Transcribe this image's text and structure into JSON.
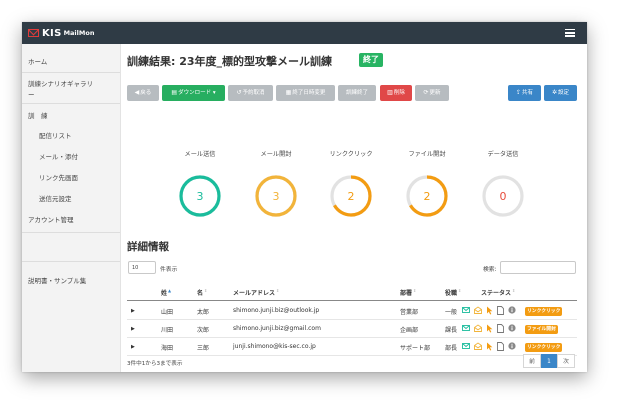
{
  "app": {
    "logo_kis": "KIS",
    "logo_suffix": "MailMon"
  },
  "sidebar": {
    "home": "ホーム",
    "gallery_1": "訓練シナリオギャラリ",
    "gallery_2": "ー",
    "training": "訓　練",
    "delivery_list": "配信リスト",
    "mail_attach": "メール・添付",
    "link_page": "リンク先画面",
    "sender_settings": "送信元設定",
    "account_mgmt": "アカウント管理",
    "manual": "説明書・サンプル集"
  },
  "header": {
    "title": "訓練結果: 23年度_標的型攻撃メール訓練",
    "status": "終了"
  },
  "toolbar": {
    "back": "戻る",
    "download": "ダウンロード",
    "cancel_schedule": "予約取消",
    "change_end_date": "終了日時変更",
    "end_training": "訓練終了",
    "delete": "削除",
    "refresh": "更新",
    "share": "共有",
    "settings": "設定"
  },
  "stats": [
    {
      "label": "メール送信",
      "value": "3",
      "color": "#1abc9c",
      "percent": 100
    },
    {
      "label": "メール開封",
      "value": "3",
      "color": "#f2b43a",
      "percent": 100
    },
    {
      "label": "リンククリック",
      "value": "2",
      "color": "#f39c12",
      "percent": 66.7
    },
    {
      "label": "ファイル開封",
      "value": "2",
      "color": "#f39c12",
      "percent": 66.7
    },
    {
      "label": "データ送信",
      "value": "0",
      "color": "#e74c3c",
      "percent": 0
    }
  ],
  "details": {
    "title": "詳細情報",
    "page_size": "10",
    "page_size_label": "件表示",
    "search_label": "検索:",
    "columns": [
      "姓",
      "名",
      "メールアドレス",
      "部署",
      "役職",
      "ステータス"
    ],
    "rows": [
      {
        "last": "山田",
        "first": "太郎",
        "email": "shimono.junji.biz@outlook.jp",
        "dept": "営業部",
        "role": "一般",
        "tag": "リンククリック",
        "tag_color": "#f39c12"
      },
      {
        "last": "川田",
        "first": "次郎",
        "email": "shimono.junji.biz@gmail.com",
        "dept": "企画部",
        "role": "課長",
        "tag": "ファイル開封",
        "tag_color": "#f39c12"
      },
      {
        "last": "海田",
        "first": "三郎",
        "email": "junji.shimono@kis-sec.co.jp",
        "dept": "サポート部",
        "role": "部長",
        "tag": "リンククリック",
        "tag_color": "#f39c12"
      }
    ],
    "footer": "3件中1から3まで表示",
    "pager": {
      "prev": "前",
      "current": "1",
      "next": "次"
    }
  }
}
